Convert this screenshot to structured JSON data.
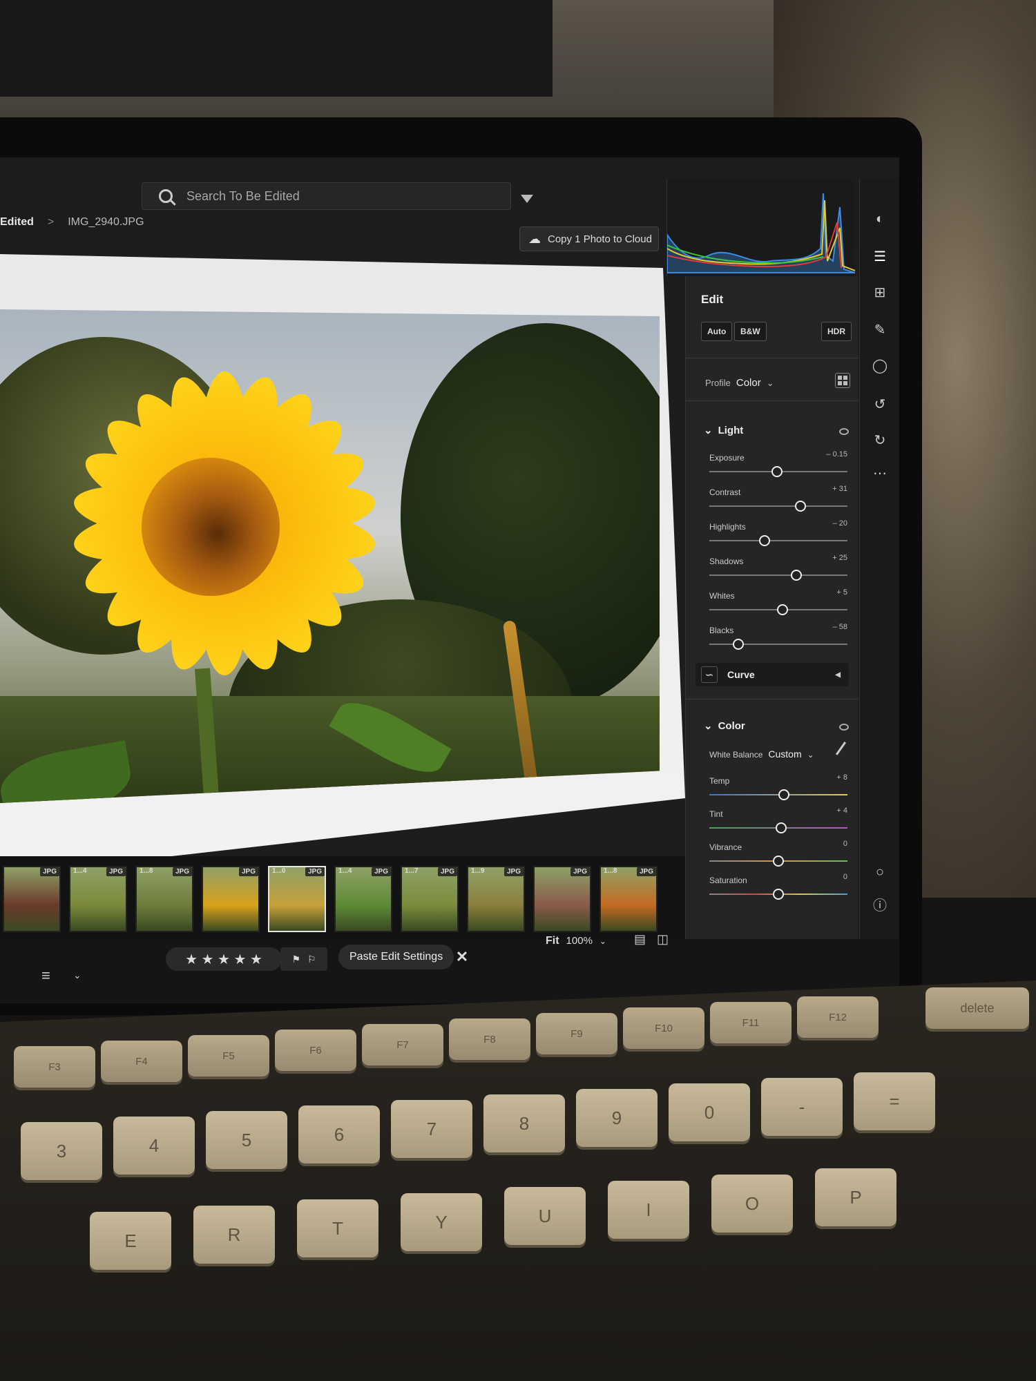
{
  "topbar": {
    "search_placeholder": "Search To Be Edited",
    "breadcrumb_first": "Edited",
    "breadcrumb_sep": ">",
    "filename": "IMG_2940.JPG",
    "copy_to_cloud": "Copy 1 Photo to Cloud",
    "icons": [
      "bell-icon",
      "share-icon",
      "help-icon",
      "cloud-warning-icon"
    ]
  },
  "edit_panel": {
    "title": "Edit",
    "auto_label": "Auto",
    "bw_label": "B&W",
    "hdr_label": "HDR",
    "profile_label": "Profile",
    "profile_value": "Color",
    "light_title": "Light",
    "light_sliders": [
      {
        "label": "Exposure",
        "display": "– 0.15",
        "pos": 0.49
      },
      {
        "label": "Contrast",
        "display": "+ 31",
        "pos": 0.66
      },
      {
        "label": "Highlights",
        "display": "– 20",
        "pos": 0.4
      },
      {
        "label": "Shadows",
        "display": "+ 25",
        "pos": 0.63
      },
      {
        "label": "Whites",
        "display": "+ 5",
        "pos": 0.53
      },
      {
        "label": "Blacks",
        "display": "– 58",
        "pos": 0.21
      }
    ],
    "curve_label": "Curve",
    "color_title": "Color",
    "white_balance_label": "White Balance",
    "white_balance_value": "Custom",
    "color_sliders": [
      {
        "label": "Temp",
        "display": "+ 8",
        "pos": 0.54,
        "kind": "temp"
      },
      {
        "label": "Tint",
        "display": "+ 4",
        "pos": 0.52,
        "kind": "tint"
      },
      {
        "label": "Vibrance",
        "display": "0",
        "pos": 0.5,
        "kind": "vib"
      },
      {
        "label": "Saturation",
        "display": "0",
        "pos": 0.5,
        "kind": "sat"
      }
    ]
  },
  "filmstrip": {
    "thumbs": [
      {
        "label": "",
        "tag": "JPG",
        "color": "#6b3a2a",
        "selected": false
      },
      {
        "label": "1...4",
        "tag": "JPG",
        "color": "#7a8a3a",
        "selected": false
      },
      {
        "label": "1...8",
        "tag": "JPG",
        "color": "#6f7d3b",
        "selected": false
      },
      {
        "label": "",
        "tag": "JPG",
        "color": "#d9a21a",
        "selected": false
      },
      {
        "label": "1...0",
        "tag": "JPG",
        "color": "#c8a13a",
        "selected": true
      },
      {
        "label": "1...4",
        "tag": "JPG",
        "color": "#5d8a35",
        "selected": false
      },
      {
        "label": "1...7",
        "tag": "JPG",
        "color": "#7b8c3c",
        "selected": false
      },
      {
        "label": "1...9",
        "tag": "JPG",
        "color": "#8a7f3c",
        "selected": false
      },
      {
        "label": "",
        "tag": "JPG",
        "color": "#8a5a4a",
        "selected": false
      },
      {
        "label": "1...8",
        "tag": "JPG",
        "color": "#c46a22",
        "selected": false
      }
    ]
  },
  "bottombar": {
    "stars": "★ ★ ★ ★ ★",
    "paste_label": "Paste Edit Settings",
    "close_symbol": "✕",
    "fit_label": "Fit",
    "zoom_label": "100%"
  },
  "keyboard": {
    "fn_keys": [
      "F3",
      "F4",
      "F5",
      "F6",
      "F7",
      "F8",
      "F9",
      "F10",
      "F11",
      "F12"
    ],
    "number_keys": [
      "3",
      "4",
      "5",
      "6",
      "7",
      "8",
      "9",
      "0",
      "-",
      "="
    ],
    "letter_keys": [
      "E",
      "R",
      "T",
      "Y",
      "U",
      "I",
      "O",
      "P"
    ],
    "delete_label": "delete"
  },
  "colors": {
    "accent": "#f2c200",
    "panel_bg": "#252525",
    "screen_bg": "#1d1d1d"
  }
}
